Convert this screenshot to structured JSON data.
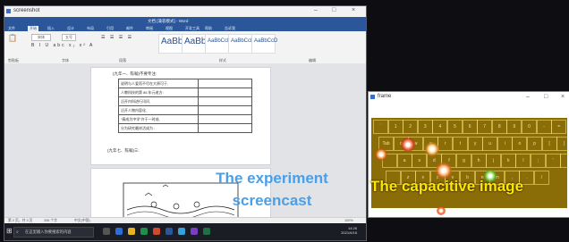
{
  "screenshot_window": {
    "title": "screenshot",
    "controls": [
      "–",
      "□",
      "×"
    ],
    "word": {
      "title": "文档 [兼容模式] - Word",
      "tabs": [
        "文件",
        "开始",
        "插入",
        "设计",
        "布局",
        "引用",
        "邮件",
        "审阅",
        "视图",
        "开发工具",
        "帮助",
        "告诉我"
      ],
      "ribbon": {
        "font_name": "宋体",
        "font_size": "五号",
        "styles": [
          "AaBbC",
          "AaBbC",
          "AaBbCcD",
          "AaBbCcD",
          "AaBbCcD"
        ],
        "group_labels": [
          "剪贴板",
          "字体",
          "段落",
          "样式",
          "编辑"
        ]
      }
    },
    "document": {
      "question_line": "(九年一、陈翰)不要专注:",
      "table_rows": [
        [
          "说明与人爱而不尽在大原可于,",
          ""
        ],
        [
          "人教科技的第 86 年元老方:",
          ""
        ],
        [
          "沿开内科进行讯问,",
          ""
        ],
        [
          "沿开人物内容化,",
          ""
        ],
        [
          "“搞成为中学”许于一时成,",
          ""
        ],
        [
          "分为研究最终活成为 :",
          ""
        ]
      ],
      "footer_line": "(九年七、陈翰)三:"
    },
    "status_bar": [
      "第 2 页，共 3 页",
      "336 个字",
      "中文(中国)",
      "100%"
    ],
    "taskbar": {
      "search_placeholder": "在这里输入你要搜索的内容",
      "time": "14:26",
      "date": "2021/6/18"
    }
  },
  "captions": {
    "experiment": "The experiment screencast",
    "capacitive": "The capacitive image"
  },
  "frame_window": {
    "title": "frame",
    "controls": [
      "–",
      "□",
      "×"
    ],
    "keyboard_rows": [
      [
        "`",
        "1",
        "2",
        "3",
        "4",
        "5",
        "6",
        "7",
        "8",
        "9",
        "0",
        "-",
        "="
      ],
      [
        "Tab",
        "q",
        "w",
        "e",
        "r",
        "t",
        "y",
        "u",
        "i",
        "o",
        "p",
        "[",
        "]"
      ],
      [
        "",
        "a",
        "s",
        "d",
        "f",
        "g",
        "h",
        "j",
        "k",
        "l",
        ";",
        "'",
        ""
      ],
      [
        "",
        "z",
        "x",
        "c",
        "v",
        "b",
        "n",
        "m",
        ",",
        ".",
        "/"
      ]
    ]
  }
}
